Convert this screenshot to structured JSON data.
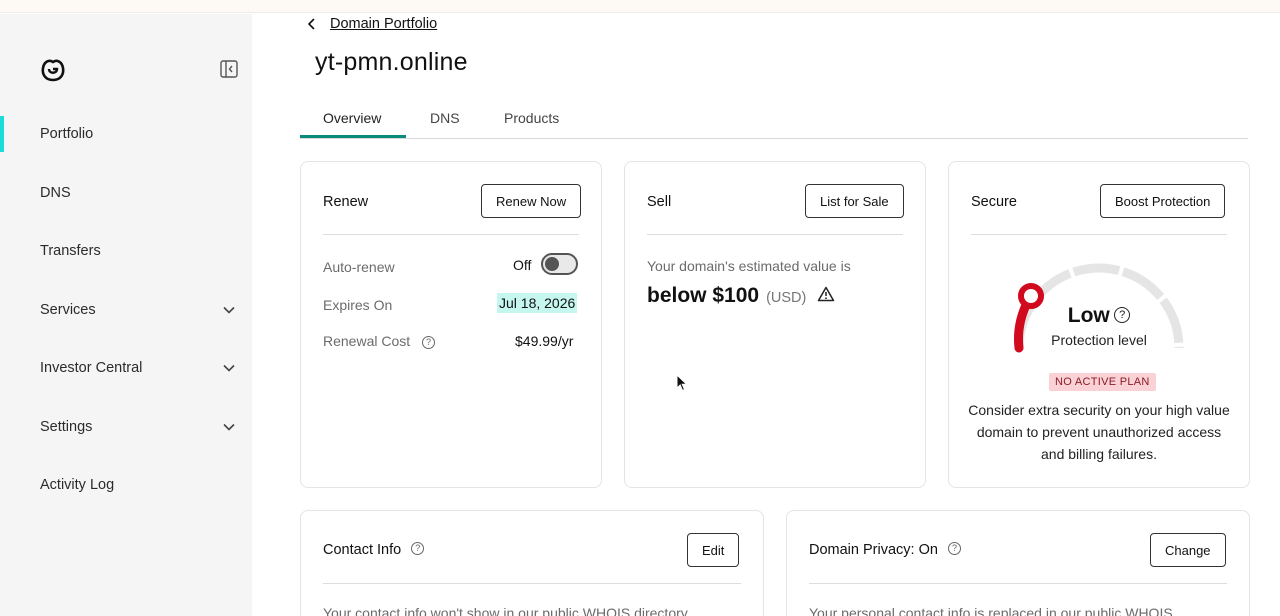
{
  "sidebar": {
    "items": [
      {
        "label": "Portfolio",
        "active": true,
        "expandable": false
      },
      {
        "label": "DNS",
        "active": false,
        "expandable": false
      },
      {
        "label": "Transfers",
        "active": false,
        "expandable": false
      },
      {
        "label": "Services",
        "active": false,
        "expandable": true
      },
      {
        "label": "Investor Central",
        "active": false,
        "expandable": true
      },
      {
        "label": "Settings",
        "active": false,
        "expandable": true
      },
      {
        "label": "Activity Log",
        "active": false,
        "expandable": false
      }
    ],
    "icons": {
      "logo": "godaddy-logo-icon",
      "collapse": "sidebar-collapse-icon",
      "expand": "chevron-down-icon"
    }
  },
  "breadcrumb": {
    "label": "Domain Portfolio"
  },
  "page": {
    "title": "yt-pmn.online"
  },
  "tabs": [
    {
      "label": "Overview",
      "active": true
    },
    {
      "label": "DNS",
      "active": false
    },
    {
      "label": "Products",
      "active": false
    }
  ],
  "renew": {
    "title": "Renew",
    "button": "Renew Now",
    "auto_renew_label": "Auto-renew",
    "auto_renew_value": "Off",
    "expires_label": "Expires On",
    "expires_value": "Jul 18, 2026",
    "cost_label": "Renewal Cost",
    "cost_value": "$49.99/yr"
  },
  "sell": {
    "title": "Sell",
    "button": "List for Sale",
    "estimate_label": "Your domain's estimated value is",
    "estimate_value": "below $100",
    "currency": "(USD)"
  },
  "secure": {
    "title": "Secure",
    "button": "Boost Protection",
    "level": "Low",
    "level_caption": "Protection level",
    "badge": "NO ACTIVE PLAN",
    "message": "Consider extra security on your high value domain to prevent unauthorized access and billing failures."
  },
  "contact": {
    "title": "Contact Info",
    "button": "Edit",
    "text": "Your contact info won't show in our public WHOIS directory"
  },
  "privacy": {
    "title": "Domain Privacy: On",
    "button": "Change",
    "text": "Your personal contact info is replaced in our public WHOIS"
  },
  "colors": {
    "accent": "#1bdbdb",
    "tab_underline": "#0a8a7a",
    "gauge_red": "#d10a1e",
    "badge_bg": "#fad2d6"
  }
}
